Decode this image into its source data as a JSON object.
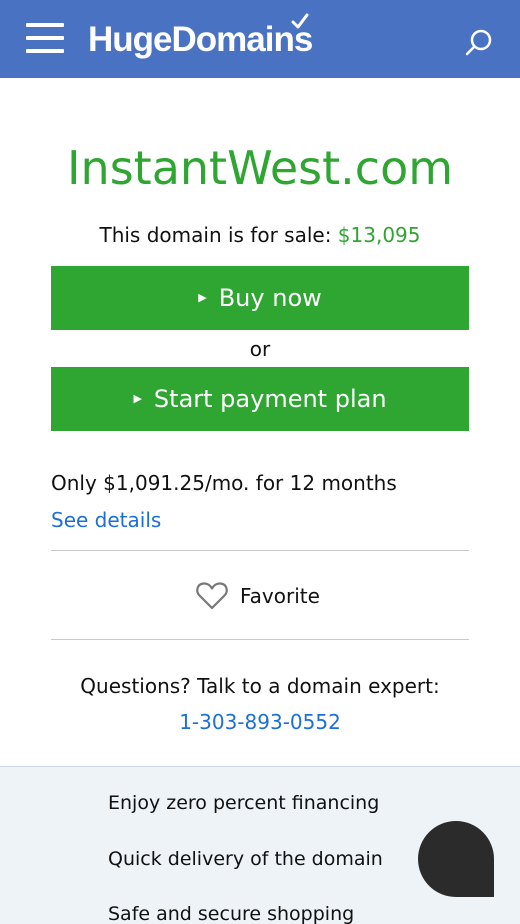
{
  "header": {
    "logo": "HugeDomains",
    "menu_icon": "hamburger-menu-icon",
    "search_icon": "search-icon",
    "brand_color": "#4a72c3"
  },
  "main": {
    "domain": "InstantWest.com",
    "for_sale_text": "This domain is for sale:",
    "price": "$13,095",
    "buy_label": "Buy now",
    "or_text": "or",
    "plan_label": "Start payment plan",
    "monthly_text": "Only $1,091.25/mo. for 12 months",
    "see_details": "See details",
    "favorite_label": "Favorite",
    "questions_text": "Questions? Talk to a domain expert:",
    "phone": "1-303-893-0552",
    "accent_color": "#2ea631",
    "link_color": "#1c6fd6"
  },
  "features": [
    "Enjoy zero percent financing",
    "Quick delivery of the domain",
    "Safe and secure shopping"
  ],
  "chat": {
    "icon": "chat-bubble-icon"
  }
}
